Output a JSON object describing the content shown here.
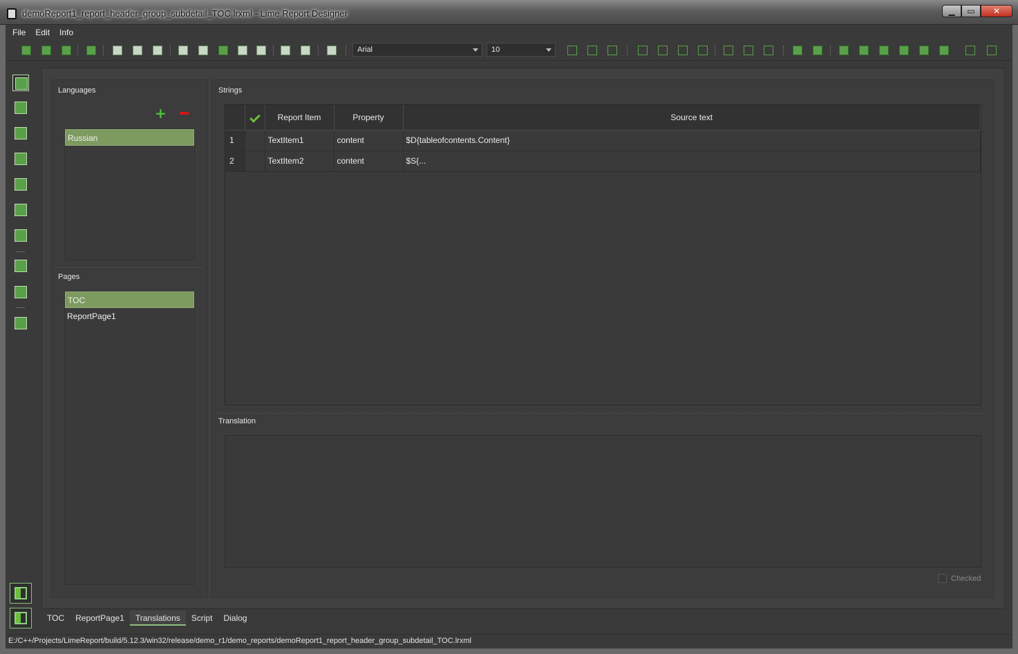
{
  "window": {
    "title": "demoReport1_report_header_group_subdetail_TOC.lrxml - Lime Report Designer",
    "minimize": "▁",
    "maximize": "▭",
    "close": "✕"
  },
  "menu": [
    "File",
    "Edit",
    "Info"
  ],
  "toolbar": {
    "font_family": "Arial",
    "font_size": "10"
  },
  "languages": {
    "label": "Languages",
    "add": "+",
    "items": [
      "Russian"
    ],
    "selected": "Russian"
  },
  "pages": {
    "label": "Pages",
    "items": [
      "TOC",
      "ReportPage1"
    ],
    "selected": "TOC"
  },
  "strings": {
    "label": "Strings",
    "columns": [
      "",
      "Report Item",
      "Property",
      "Source text"
    ],
    "rows": [
      {
        "num": "1",
        "item": "TextItem1",
        "property": "content",
        "source": "$D{tableofcontents.Content}"
      },
      {
        "num": "2",
        "item": "TextItem2",
        "property": "content",
        "source": "$S{..."
      }
    ]
  },
  "translation": {
    "label": "Translation",
    "checked_label": "Checked",
    "checked": false
  },
  "tabs": [
    "TOC",
    "ReportPage1",
    "Translations",
    "Script",
    "Dialog"
  ],
  "active_tab": "Translations",
  "status": "E:/C++/Projects/LimeReport/build/5.12.3/win32/release/demo_r1/demo_reports/demoReport1_report_header_group_subdetail_TOC.lrxml",
  "colors": {
    "accent": "#7d9a5f",
    "icon_green": "#5aa04a",
    "remove_red": "#d01818",
    "background": "#3a3a3a"
  }
}
